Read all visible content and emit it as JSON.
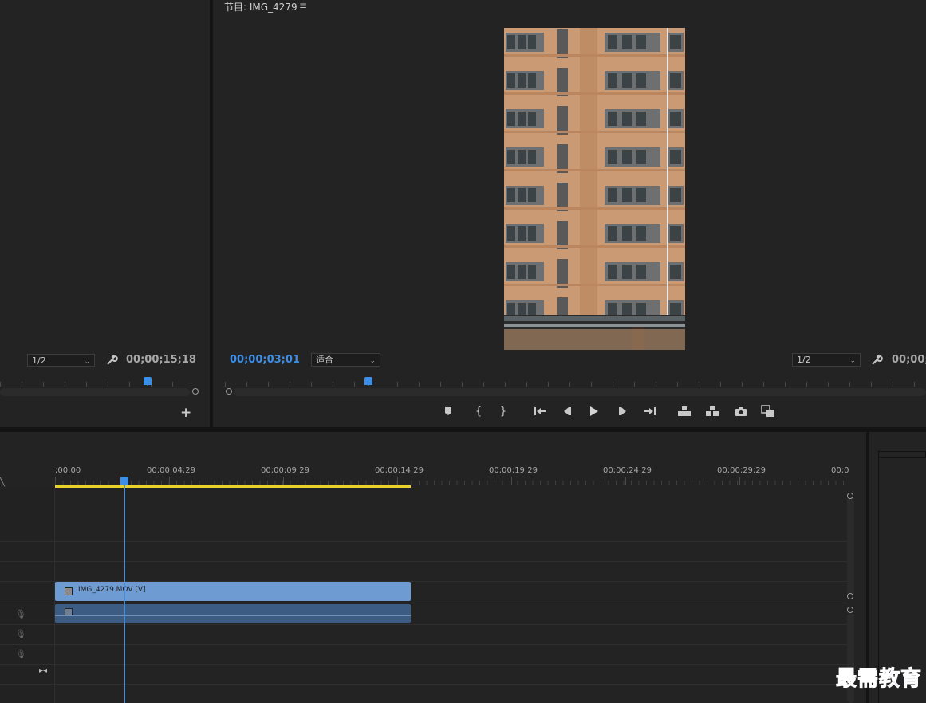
{
  "source_monitor": {
    "resolution": "1/2",
    "timecode": "00;00;15;18"
  },
  "program_monitor": {
    "title": "节目: IMG_4279",
    "timecode": "00;00;03;01",
    "zoom": "适合",
    "resolution": "1/2",
    "timecode_right": "00;00;",
    "controls": [
      "marker-icon",
      "mark-in-icon",
      "mark-out-icon",
      "go-to-in-icon",
      "step-back-icon",
      "play-icon",
      "step-forward-icon",
      "go-to-out-icon",
      "lift-icon",
      "extract-icon",
      "export-frame-icon",
      "compare-view-icon"
    ]
  },
  "timeline": {
    "ruler_labels": [
      ";00;00",
      "00;00;04;29",
      "00;00;09;29",
      "00;00;14;29",
      "00;00;19;29",
      "00;00;24;29",
      "00;00;29;29",
      "00;0"
    ],
    "video_clip_label": "IMG_4279.MOV [V]"
  },
  "watermark": "最需教育",
  "colors": {
    "accent_blue": "#3c8ee6",
    "work_area_yellow": "#e6d22a",
    "video_clip": "#6e9bd1",
    "audio_clip": "#3d5c84"
  }
}
